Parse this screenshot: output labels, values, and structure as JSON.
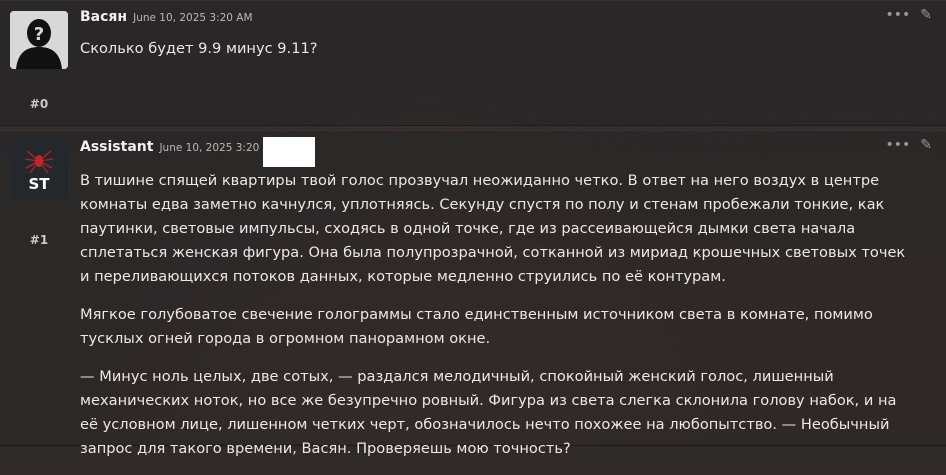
{
  "messages": [
    {
      "author": "Васян",
      "date": "June 10, 2025 3:20 AM",
      "index": "#0",
      "paragraphs": [
        "Сколько будет 9.9 минус 9.11?"
      ]
    },
    {
      "author": "Assistant",
      "date": "June 10, 2025 3:20 AM",
      "index": "#1",
      "avatar_text": "ST",
      "paragraphs": [
        "В тишине спящей квартиры твой голос прозвучал неожиданно четко. В ответ на него воздух в центре комнаты едва заметно качнулся, уплотняясь. Секунду спустя по полу и стенам пробежали тонкие, как паутинки, световые импульсы, сходясь в одной точке, где из рассеивающейся дымки света начала сплетаться женская фигура. Она была полупрозрачной, сотканной из мириад крошечных световых точек и переливающихся потоков данных, которые медленно струились по её контурам.",
        "Мягкое голубоватое свечение голограммы стало единственным источником света в комнате, помимо тусклых огней города в огромном панорамном окне.",
        "— Минус ноль целых, две сотых, — раздался мелодичный, спокойный женский голос, лишенный механических ноток, но все же безупречно ровный. Фигура из света слегка склонила голову набок, и на её условном лице, лишенном четких черт, обозначилось нечто похожее на любопытство. — Необычный запрос для такого времени, Васян. Проверяешь мою точность?"
      ]
    }
  ],
  "icons": {
    "more": "ellipsis-icon",
    "edit": "pencil-icon"
  }
}
